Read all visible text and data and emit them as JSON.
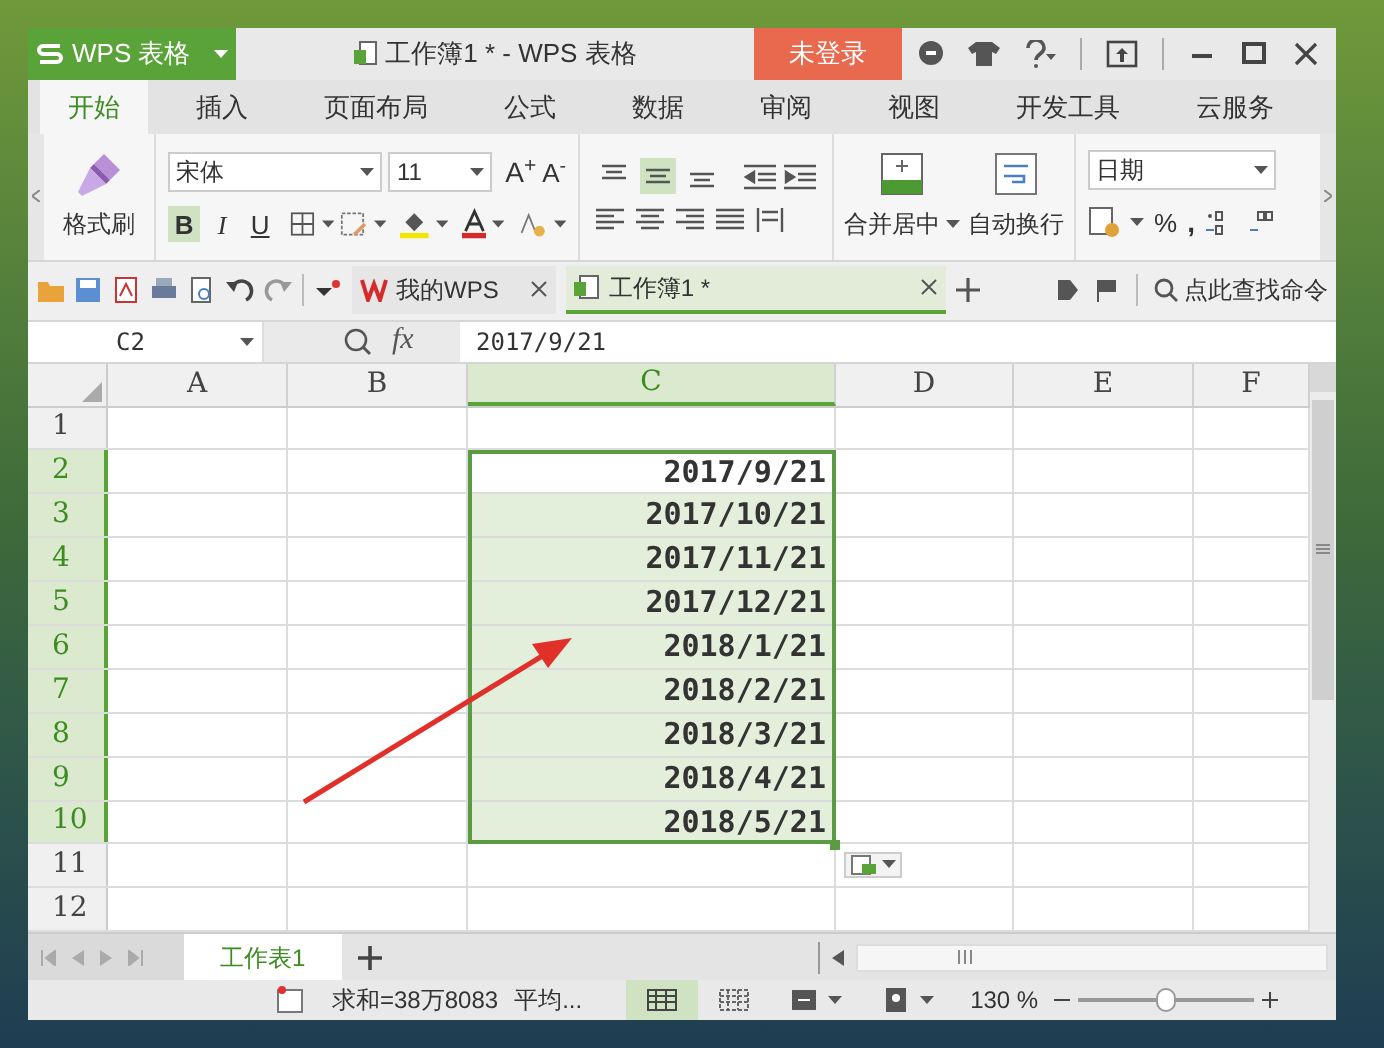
{
  "app_menu": {
    "label": "WPS 表格"
  },
  "window": {
    "title": "工作簿1 * - WPS 表格"
  },
  "login_button": {
    "label": "未登录"
  },
  "ribbon_tabs": [
    {
      "label": "开始",
      "selected": true
    },
    {
      "label": "插入",
      "selected": false
    },
    {
      "label": "页面布局",
      "selected": false
    },
    {
      "label": "公式",
      "selected": false
    },
    {
      "label": "数据",
      "selected": false
    },
    {
      "label": "审阅",
      "selected": false
    },
    {
      "label": "视图",
      "selected": false
    },
    {
      "label": "开发工具",
      "selected": false
    },
    {
      "label": "云服务",
      "selected": false
    }
  ],
  "ribbon": {
    "format_painter": "格式刷",
    "font_name": "宋体",
    "font_size": "11",
    "grow_font": "A$^{+}$",
    "shrink_font": "A$^{-}$",
    "style_buttons": [
      {
        "label": "B",
        "on": true
      },
      {
        "label": "I",
        "on": false
      },
      {
        "label": "U",
        "on": false
      }
    ],
    "align_buttons": [
      {
        "kind": "top",
        "on": false
      },
      {
        "kind": "middle",
        "on": true
      },
      {
        "kind": "bottom",
        "on": false
      }
    ],
    "merge_center": "合并居中",
    "wrap_text": "自动换行",
    "number_format": "日期",
    "percent": "%",
    "comma": ","
  },
  "doc_tabs": [
    {
      "label": "我的WPS",
      "selected": false
    },
    {
      "label": "工作簿1 *",
      "selected": true
    }
  ],
  "command_search": {
    "placeholder": "点此查找命令"
  },
  "formula_bar": {
    "name_box": "C2",
    "fx": "fx",
    "value": "2017/9/21"
  },
  "sheet": {
    "columns": [
      {
        "label": "A",
        "selected": false
      },
      {
        "label": "B",
        "selected": false
      },
      {
        "label": "C",
        "selected": true
      },
      {
        "label": "D",
        "selected": false
      },
      {
        "label": "E",
        "selected": false
      },
      {
        "label": "F",
        "selected": false
      }
    ],
    "rows": [
      {
        "number": "1",
        "selected": false
      },
      {
        "number": "2",
        "selected": true,
        "value": "2017/9/21",
        "active": true
      },
      {
        "number": "3",
        "selected": true,
        "value": "2017/10/21",
        "active": false
      },
      {
        "number": "4",
        "selected": true,
        "value": "2017/11/21",
        "active": false
      },
      {
        "number": "5",
        "selected": true,
        "value": "2017/12/21",
        "active": false
      },
      {
        "number": "6",
        "selected": true,
        "value": "2018/1/21",
        "active": false
      },
      {
        "number": "7",
        "selected": true,
        "value": "2018/2/21",
        "active": false
      },
      {
        "number": "8",
        "selected": true,
        "value": "2018/3/21",
        "active": false
      },
      {
        "number": "9",
        "selected": true,
        "value": "2018/4/21",
        "active": false
      },
      {
        "number": "10",
        "selected": true,
        "value": "2018/5/21",
        "active": false
      },
      {
        "number": "11",
        "selected": false
      },
      {
        "number": "12",
        "selected": false
      }
    ]
  },
  "sheet_tabs": [
    {
      "label": "工作表1",
      "selected": true
    }
  ],
  "status_bar": {
    "summary": "求和=38万8083",
    "average": "平均...",
    "view_buttons": [
      {
        "kind": "normal",
        "selected": true
      },
      {
        "kind": "page_break",
        "selected": false
      },
      {
        "kind": "reading",
        "selected": false
      },
      {
        "kind": "eye",
        "selected": false
      }
    ],
    "zoom": "130 %",
    "zoom_slider": {
      "level": 0.5
    }
  }
}
